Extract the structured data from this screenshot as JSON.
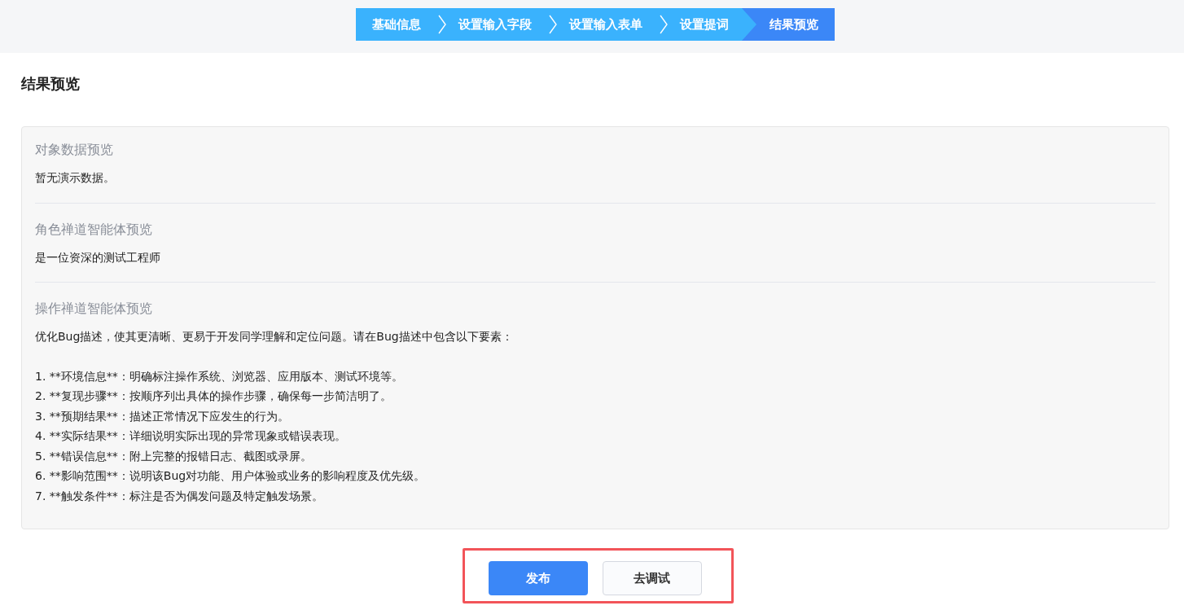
{
  "steps": [
    {
      "label": "基础信息",
      "selected": false
    },
    {
      "label": "设置输入字段",
      "selected": false
    },
    {
      "label": "设置输入表单",
      "selected": false
    },
    {
      "label": "设置提词",
      "selected": false
    },
    {
      "label": "结果预览",
      "selected": true
    }
  ],
  "page_title": "结果预览",
  "sections": [
    {
      "title": "对象数据预览",
      "paragraphs": [
        [
          "暂无演示数据。"
        ]
      ]
    },
    {
      "title": "角色禅道智能体预览",
      "paragraphs": [
        [
          "是一位资深的测试工程师"
        ]
      ]
    },
    {
      "title": "操作禅道智能体预览",
      "paragraphs": [
        [
          "优化Bug描述，使其更清晰、更易于开发同学理解和定位问题。请在Bug描述中包含以下要素："
        ],
        [
          "1. **环境信息**：明确标注操作系统、浏览器、应用版本、测试环境等。",
          "2. **复现步骤**：按顺序列出具体的操作步骤，确保每一步简洁明了。",
          "3. **预期结果**：描述正常情况下应发生的行为。",
          "4. **实际结果**：详细说明实际出现的异常现象或错误表现。",
          "5. **错误信息**：附上完整的报错日志、截图或录屏。",
          "6. **影响范围**：说明该Bug对功能、用户体验或业务的影响程度及优先级。",
          "7. **触发条件**：标注是否为偶发问题及特定触发场景。"
        ]
      ]
    }
  ],
  "buttons": [
    {
      "label": "发布",
      "kind": "primary"
    },
    {
      "label": "去调试",
      "kind": "secondary"
    }
  ]
}
